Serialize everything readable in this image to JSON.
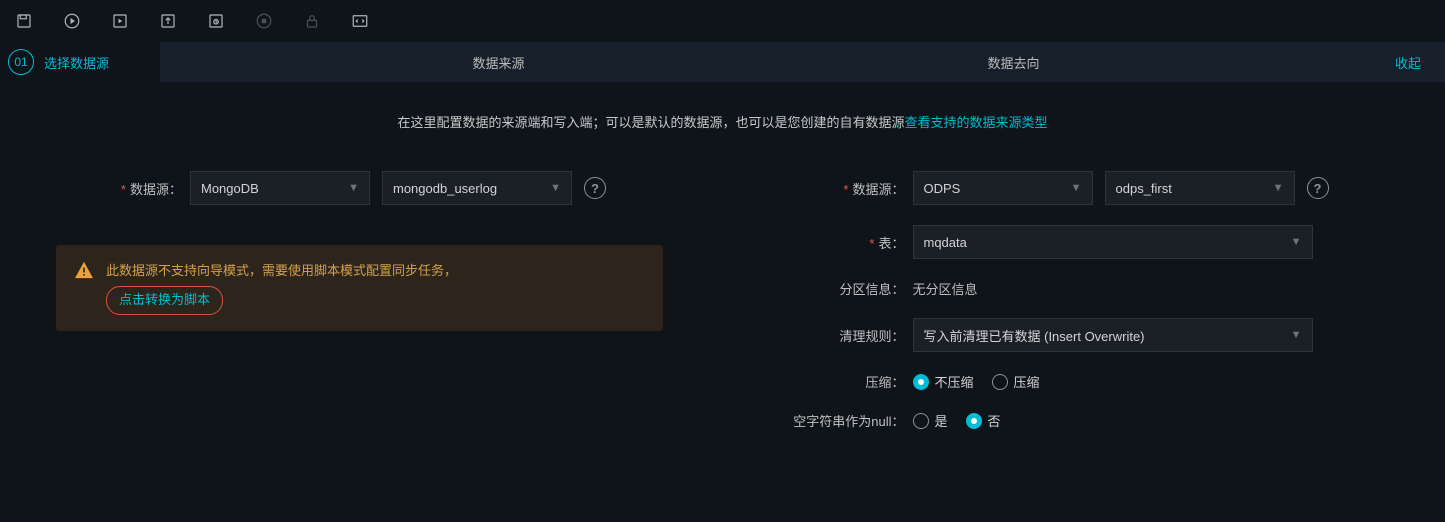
{
  "toolbar": {
    "icons": [
      "save",
      "run",
      "run-scheduled",
      "export",
      "history",
      "stop",
      "lock",
      "code"
    ]
  },
  "step": {
    "number": "01",
    "label": "选择数据源",
    "src_header": "数据来源",
    "dst_header": "数据去向",
    "collapse": "收起"
  },
  "intro": {
    "text": "在这里配置数据的来源端和写入端；可以是默认的数据源，也可以是您创建的自有数据源",
    "link": "查看支持的数据来源类型"
  },
  "source": {
    "ds_label": "数据源",
    "type_value": "MongoDB",
    "name_value": "mongodb_userlog",
    "warning_text": "此数据源不支持向导模式，需要使用脚本模式配置同步任务，",
    "script_link": "点击转换为脚本"
  },
  "target": {
    "ds_label": "数据源",
    "type_value": "ODPS",
    "name_value": "odps_first",
    "table_label": "表",
    "table_value": "mqdata",
    "partition_label": "分区信息",
    "partition_value": "无分区信息",
    "clean_label": "清理规则",
    "clean_value": "写入前清理已有数据 (Insert Overwrite)",
    "compress_label": "压缩",
    "compress_opt1": "不压缩",
    "compress_opt2": "压缩",
    "null_label": "空字符串作为null",
    "null_opt1": "是",
    "null_opt2": "否"
  }
}
